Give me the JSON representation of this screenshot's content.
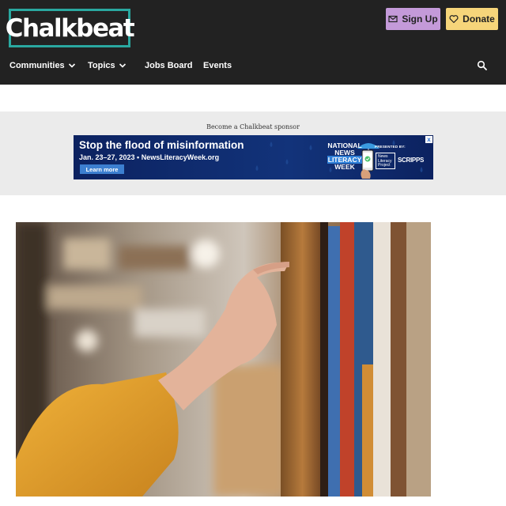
{
  "header": {
    "logo_text": "Chalkbeat",
    "signup_label": "Sign Up",
    "donate_label": "Donate",
    "background": "#222222",
    "logo_border_color": "#2aa8a0",
    "signup_color": "#c49ad9",
    "donate_color": "#f6d57a"
  },
  "nav": {
    "items": [
      {
        "label": "Communities",
        "icon": "chevron-down-icon"
      },
      {
        "label": "Topics",
        "icon": "chevron-down-icon"
      },
      {
        "label": "Jobs Board"
      },
      {
        "label": "Events"
      }
    ],
    "search_icon": "search-icon"
  },
  "sponsor": {
    "label": "Become a Chalkbeat sponsor"
  },
  "ad": {
    "headline": "Stop the flood of misinformation",
    "dates": "Jan. 23–27, 2023  •  NewsLiteracyWeek.org",
    "button": "Learn more",
    "event_line1": "NATIONAL",
    "event_line2": "NEWS",
    "event_line3": "LITERACY",
    "event_line4": "WEEK",
    "presented_by": "PRESENTED BY:",
    "partner_line1": "News",
    "partner_line2": "Literacy",
    "partner_line3": "Project",
    "sponsor_name": "SCRIPPS",
    "close": "x"
  },
  "hero": {
    "icon": "bookshelf-photo"
  }
}
